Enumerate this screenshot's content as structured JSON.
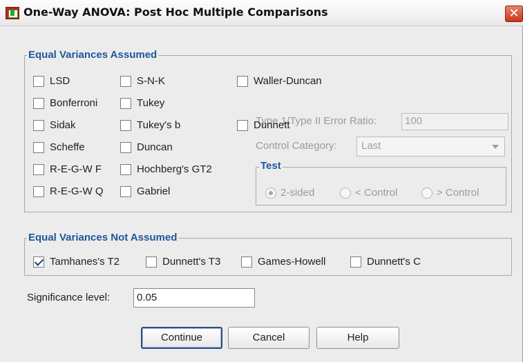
{
  "window": {
    "title": "One-Way ANOVA: Post Hoc Multiple Comparisons",
    "close_glyph": "✕",
    "icon": "spss-dialog-icon"
  },
  "equal_variances_assumed": {
    "label": "Equal Variances Assumed",
    "tests": [
      {
        "label": "LSD",
        "checked": false
      },
      {
        "label": "Bonferroni",
        "checked": false
      },
      {
        "label": "Sidak",
        "checked": false
      },
      {
        "label": "Scheffe",
        "checked": false
      },
      {
        "label": "R-E-G-W F",
        "checked": false
      },
      {
        "label": "R-E-G-W Q",
        "checked": false
      },
      {
        "label": "S-N-K",
        "checked": false
      },
      {
        "label": "Tukey",
        "checked": false
      },
      {
        "label": "Tukey's b",
        "checked": false
      },
      {
        "label": "Duncan",
        "checked": false
      },
      {
        "label": "Hochberg's GT2",
        "checked": false
      },
      {
        "label": "Gabriel",
        "checked": false
      },
      {
        "label": "Waller-Duncan",
        "checked": false
      },
      {
        "label": "Dunnett",
        "checked": false
      }
    ],
    "error_ratio_label": "Type 1/Type II Error Ratio:",
    "error_ratio_value": "100",
    "control_category_label": "Control Category:",
    "control_category_value": "Last",
    "test_group": {
      "label": "Test",
      "options": [
        "2-sided",
        "< Control",
        "> Control"
      ],
      "selected": "2-sided"
    }
  },
  "equal_variances_not_assumed": {
    "label": "Equal Variances Not Assumed",
    "tests": [
      {
        "label": "Tamhanes's T2",
        "checked": true
      },
      {
        "label": "Dunnett's T3",
        "checked": false
      },
      {
        "label": "Games-Howell",
        "checked": false
      },
      {
        "label": "Dunnett's C",
        "checked": false
      }
    ]
  },
  "significance": {
    "label": "Significance level:",
    "value": "0.05"
  },
  "buttons": {
    "continue": "Continue",
    "cancel": "Cancel",
    "help": "Help"
  },
  "colors": {
    "group_label": "#1f5799",
    "dialog_bg": "#ececec",
    "close_button": "#c9341b"
  }
}
